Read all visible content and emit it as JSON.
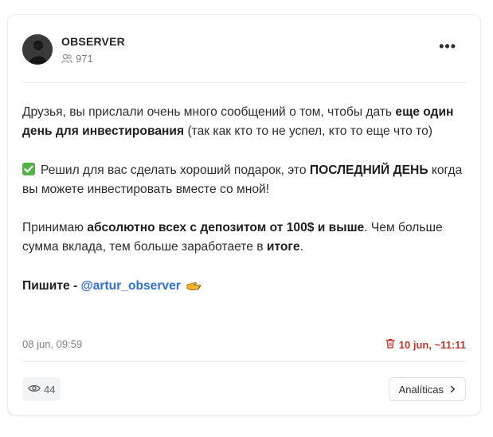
{
  "channel": {
    "name": "OBSERVER",
    "subscribers": "971"
  },
  "post": {
    "p1_a": "Друзья, вы прислали очень много сообщений о том, чтобы дать",
    "p1_b": "еще один день для инвестирования",
    "p1_c": " (так как кто то не успел, кто то еще что то)",
    "p2_a": "Решил для вас сделать хороший подарок, это ",
    "p2_b": "ПОСЛЕДНИЙ ДЕНЬ",
    "p2_c": " когда вы можете инвестировать вместе со мной!",
    "p3_a": "Принимаю ",
    "p3_b": "абсолютно всех с депозитом от 100$ и выше",
    "p3_c": ". Чем больше сумма вклада, тем больше заработаете в ",
    "p3_d": "итоге",
    "p3_e": ".",
    "p4_a": "Пишите - ",
    "p4_mention": "@artur_observer"
  },
  "meta": {
    "date": "08 jun, 09:59",
    "deleted": "10 jun, ~11:11"
  },
  "footer": {
    "views": "44",
    "analytics_label": "Analíticas"
  },
  "icons": {
    "more": "more-dots-icon",
    "subscribers": "users-icon",
    "checkmark": "check-emoji-icon",
    "hand": "pointing-hand-icon",
    "trash": "trash-icon",
    "eye": "eye-icon",
    "chevron": "chevron-right-icon"
  },
  "colors": {
    "mention": "#2f6fd6",
    "deleted": "#c0392b",
    "check": "#56b04a"
  }
}
